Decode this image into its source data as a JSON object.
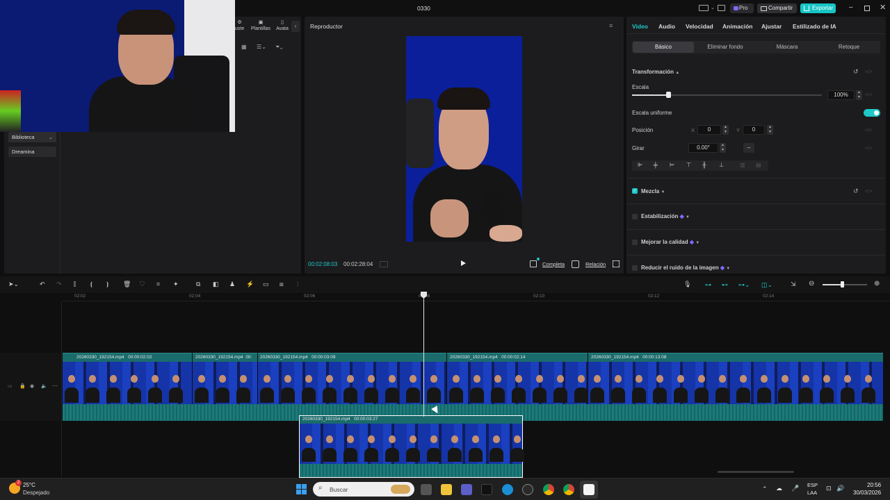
{
  "window": {
    "title": "0330",
    "pro_badge": "Pro",
    "share_label": "Compartir",
    "export_label": "Exportar"
  },
  "left_panel": {
    "toolbar": [
      "uste",
      "Plantillas",
      "Avata"
    ],
    "menu": [
      {
        "label": "Biblioteca"
      },
      {
        "label": "Dreamina"
      }
    ]
  },
  "player": {
    "title": "Reproductor",
    "current_time": "00:02:08:03",
    "total_time": "00:02:28:04",
    "full_label": "Completa",
    "ratio_label": "Relación"
  },
  "inspector": {
    "tabs": [
      "Video",
      "Audio",
      "Velocidad",
      "Animación",
      "Ajustar",
      "Estilizado de IA"
    ],
    "subtabs": [
      "Básico",
      "Eliminar fondo",
      "Máscara",
      "Retoque"
    ],
    "transform_label": "Transformación",
    "scale_label": "Escala",
    "scale_value": "100%",
    "scale_fraction": 0.19,
    "uniform_label": "Escala uniforme",
    "position_label": "Posición",
    "pos_x_label": "X",
    "pos_x": "0",
    "pos_y_label": "Y",
    "pos_y": "0",
    "rotate_label": "Girar",
    "rotate_value": "0.00°",
    "rotate_button": "–",
    "blend_label": "Mezcla",
    "stabilize_label": "Estabilización",
    "enhance_label": "Mejorar la calidad",
    "denoise_label": "Reducir el ruido de la imagen"
  },
  "timeline": {
    "ruler": [
      "02:02",
      "02:04",
      "02:06",
      "02:08",
      "02:10",
      "02:12",
      "02:14"
    ],
    "clips": [
      {
        "name": "20260330_192154.mp4",
        "duration": "00:00:02:02"
      },
      {
        "name": "20260330_192154.mp4",
        "duration": "00:"
      },
      {
        "name": "20260330_192154.mp4",
        "duration": "00:00:03:09"
      },
      {
        "name": "20260330_192154.mp4",
        "duration": "00:00:02:14"
      },
      {
        "name": "20260330_192154.mp4",
        "duration": "00:00:13:08"
      }
    ],
    "overlay_clip": {
      "name": "20260330_192154.mp4",
      "duration": "00:00:03:27"
    }
  },
  "taskbar": {
    "temperature": "25°C",
    "weather": "Despejado",
    "weather_badge": "2",
    "search_placeholder": "Buscar",
    "lang": "ESP",
    "region": "LAA",
    "time": "20:56",
    "date": "30/03/2026"
  },
  "colors": {
    "accent": "#1fc8c8",
    "clip": "#1a6b6b",
    "track_bg": "#0f0f10"
  }
}
